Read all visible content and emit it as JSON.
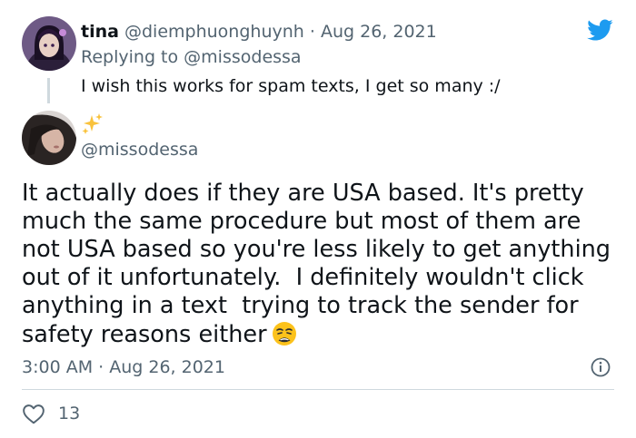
{
  "reply": {
    "display_name": "tina",
    "handle": "@diemphuonghuynh",
    "separator": "·",
    "date": "Aug 26, 2021",
    "replying_prefix": "Replying to",
    "replying_mention": "@missodessa",
    "text": "I wish this works for spam texts, I get so many :/"
  },
  "main": {
    "name_emoji": "sparkles",
    "handle": "@missodessa",
    "text_lines": [
      "It actually does if they are USA based. It's pretty",
      "much the same procedure but most of them are",
      "not USA based so you're less likely to get anything",
      "out of it unfortunately.  I definitely wouldn't click",
      "anything in a text  trying to track the sender for",
      "safety reasons either"
    ],
    "trailing_emoji": "weary-face",
    "timestamp": "3:00 AM · Aug 26, 2021",
    "like_count": "13"
  },
  "icons": {
    "brand": "twitter-bird-icon",
    "info": "info-icon",
    "like": "heart-icon"
  },
  "colors": {
    "twitter_blue": "#1d9bf0",
    "secondary_text": "#536471",
    "primary_text": "#0f1419",
    "divider": "#cfd9de"
  }
}
